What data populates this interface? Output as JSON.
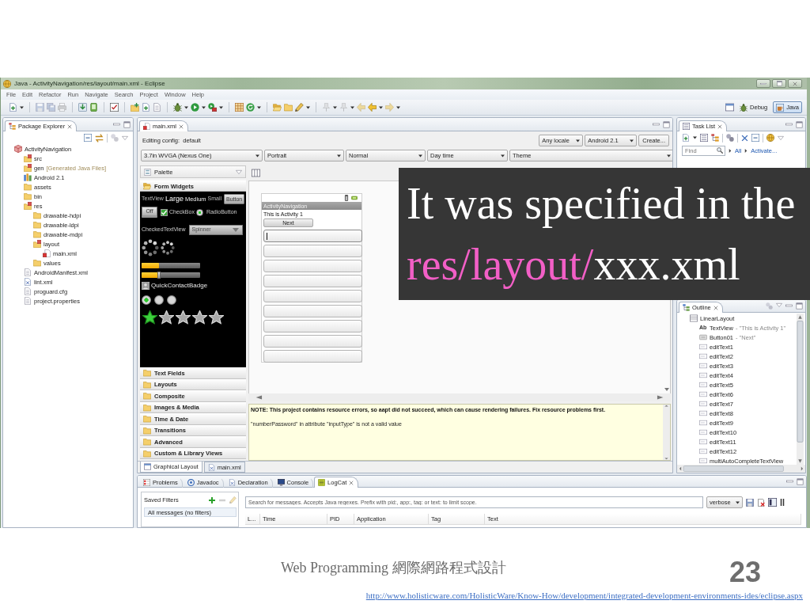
{
  "window": {
    "title": "Java - ActivityNavigation/res/layout/main.xml - Eclipse"
  },
  "menu": [
    "File",
    "Edit",
    "Refactor",
    "Run",
    "Navigate",
    "Search",
    "Project",
    "Window",
    "Help"
  ],
  "perspectives": [
    {
      "label": "Debug",
      "selected": false
    },
    {
      "label": "Java",
      "selected": true
    }
  ],
  "package_explorer": {
    "title": "Package Explorer",
    "tree": [
      {
        "label": "ActivityNavigation",
        "kind": "project",
        "children": [
          {
            "label": "src",
            "kind": "source"
          },
          {
            "label": "gen",
            "note": "[Generated Java Files]",
            "kind": "source"
          },
          {
            "label": "Android 2.1",
            "kind": "library"
          },
          {
            "label": "assets",
            "kind": "folder"
          },
          {
            "label": "bin",
            "kind": "folder"
          },
          {
            "label": "res",
            "kind": "source",
            "children": [
              {
                "label": "drawable-hdpi",
                "kind": "folder"
              },
              {
                "label": "drawable-ldpi",
                "kind": "folder"
              },
              {
                "label": "drawable-mdpi",
                "kind": "folder"
              },
              {
                "label": "layout",
                "kind": "source",
                "children": [
                  {
                    "label": "main.xml",
                    "kind": "layout-file"
                  }
                ]
              },
              {
                "label": "values",
                "kind": "folder"
              }
            ]
          },
          {
            "label": "AndroidManifest.xml",
            "kind": "file"
          },
          {
            "label": "lint.xml",
            "kind": "xml-file"
          },
          {
            "label": "proguard.cfg",
            "kind": "file"
          },
          {
            "label": "project.properties",
            "kind": "file"
          }
        ]
      }
    ]
  },
  "editor": {
    "tab": "main.xml",
    "config": "Editing config:  default",
    "locale": "Any locale",
    "target": "Android 2.1",
    "create": "Create...",
    "options": [
      "3.7in WVGA (Nexus One)",
      "Portrait",
      "Normal",
      "Day time",
      "Theme"
    ],
    "palette": {
      "title": "Palette",
      "sections": [
        {
          "label": "Form Widgets",
          "expanded": true
        },
        {
          "label": "Text Fields",
          "expanded": false
        },
        {
          "label": "Layouts",
          "expanded": false
        },
        {
          "label": "Composite",
          "expanded": false
        },
        {
          "label": "Images & Media",
          "expanded": false
        },
        {
          "label": "Time & Date",
          "expanded": false
        },
        {
          "label": "Transitions",
          "expanded": false
        },
        {
          "label": "Advanced",
          "expanded": false
        },
        {
          "label": "Custom & Library Views",
          "expanded": false
        }
      ],
      "preview": {
        "texts": [
          {
            "text": "TextView",
            "kind": "plain"
          },
          {
            "text": "Large",
            "kind": "large"
          },
          {
            "text": "Medium",
            "kind": "medium"
          },
          {
            "text": "Small",
            "kind": "small"
          }
        ],
        "button": "Button",
        "toggle": "Off",
        "checkbox": {
          "label": "CheckBox",
          "checked": true
        },
        "radio": {
          "label": "RadioButton",
          "checked": true
        },
        "checked_text": "CheckedTextView",
        "spinner": "Spinner",
        "progress": {
          "level": 0.3
        },
        "seek": {
          "level": 0.3
        },
        "badge": "QuickContactBadge",
        "radio_group": [
          {
            "selected": true
          },
          {
            "selected": false
          },
          {
            "selected": false
          }
        ],
        "rating": {
          "stars": 1
        }
      }
    },
    "device": {
      "app_title": "ActivityNavigation",
      "text": "This is Activity 1",
      "button": "Next",
      "edit_fields": [
        {
          "focused": true
        },
        {
          "focused": false
        },
        {
          "focused": false
        },
        {
          "focused": false
        },
        {
          "focused": false
        },
        {
          "focused": false
        },
        {
          "focused": false
        },
        {
          "focused": false
        },
        {
          "focused": false
        }
      ]
    },
    "notice": "NOTE: This project contains resource errors, so aapt did not succeed, which can cause rendering failures. Fix resource problems first.",
    "error": "\"numberPassword\" in attribute \"inputType\" is not a valid value",
    "view_tabs": [
      {
        "label": "Graphical Layout",
        "selected": true
      },
      {
        "label": "main.xml",
        "selected": false
      }
    ]
  },
  "task_list": {
    "title": "Task List",
    "find_placeholder": "Find",
    "links": [
      "All",
      "Activate..."
    ]
  },
  "outline": {
    "title": "Outline",
    "tree": [
      {
        "label": "LinearLayout",
        "kind": "layout",
        "children": [
          {
            "label": "TextView",
            "glyph": "Ab",
            "note": "- \"This is Activity 1\"",
            "kind": "text"
          },
          {
            "label": "Button01",
            "note": "- \"Next\"",
            "kind": "button"
          },
          {
            "label": "editText1",
            "kind": "edit"
          },
          {
            "label": "editText2",
            "kind": "edit"
          },
          {
            "label": "editText3",
            "kind": "edit"
          },
          {
            "label": "editText4",
            "kind": "edit"
          },
          {
            "label": "editText5",
            "kind": "edit"
          },
          {
            "label": "editText6",
            "kind": "edit"
          },
          {
            "label": "editText7",
            "kind": "edit"
          },
          {
            "label": "editText8",
            "kind": "edit"
          },
          {
            "label": "editText9",
            "kind": "edit"
          },
          {
            "label": "editText10",
            "kind": "edit"
          },
          {
            "label": "editText11",
            "kind": "edit"
          },
          {
            "label": "editText12",
            "kind": "edit"
          },
          {
            "label": "multiAutoCompleteTextView",
            "kind": "edit"
          }
        ]
      }
    ]
  },
  "bottom_panel": {
    "tabs": [
      {
        "label": "Problems",
        "selected": false
      },
      {
        "label": "Javadoc",
        "selected": false
      },
      {
        "label": "Declaration",
        "selected": false
      },
      {
        "label": "Console",
        "selected": false
      },
      {
        "label": "LogCat",
        "selected": true
      }
    ],
    "saved_filters": {
      "title": "Saved Filters",
      "items": [
        {
          "label": "All messages (no filters)",
          "selected": true
        }
      ]
    },
    "search_placeholder": "Search for messages. Accepts Java regexes. Prefix with pid:, app:, tag: or text: to limit scope.",
    "level": "verbose",
    "columns": [
      "L...",
      "Time",
      "PID",
      "Application",
      "Tag",
      "Text"
    ]
  },
  "caption": {
    "lines": [
      [
        {
          "text": "It was specified in the",
          "highlight": false
        }
      ],
      [
        {
          "text": "res/layout/",
          "highlight": true
        },
        {
          "text": "xxx.xml",
          "highlight": false
        }
      ]
    ]
  },
  "footer": {
    "course": "Web Programming 網際網路程式設計",
    "page": "23",
    "source_url": "http://www.holisticware.com/HolisticWare/Know-How/development/integrated-development-environments-ides/eclipse.aspx"
  }
}
